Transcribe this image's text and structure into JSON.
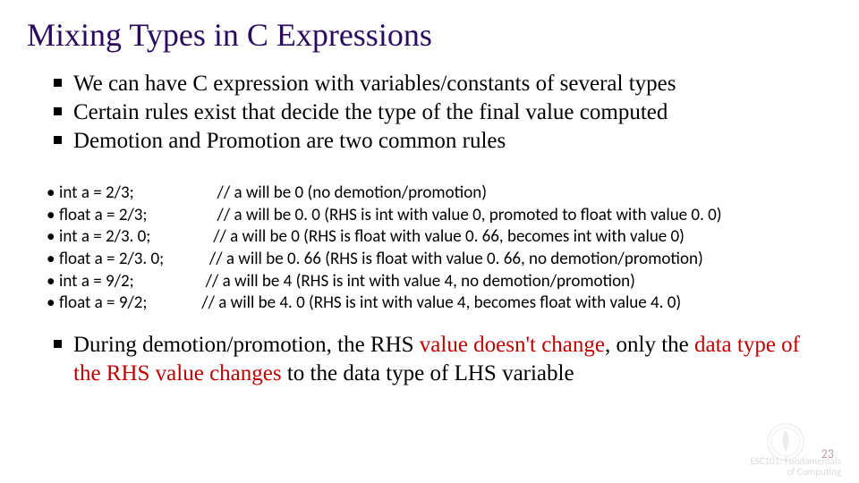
{
  "title": "Mixing Types in C Expressions",
  "intro": [
    "We can have C expression with variables/constants of several types",
    "Certain rules exist that decide the type of the final value computed",
    "Demotion and Promotion are two common rules"
  ],
  "examples": [
    {
      "decl": "int a = 2/3;",
      "comment": "// a will be 0 (no demotion/promotion)"
    },
    {
      "decl": "float a = 2/3;",
      "comment": "// a will be 0. 0 (RHS is int with value 0, promoted to float with value 0. 0)"
    },
    {
      "decl": "int a = 2/3. 0;",
      "comment": "// a will be 0 (RHS is float with value 0. 66, becomes int with value 0)"
    },
    {
      "decl": "float a = 2/3. 0;",
      "comment": "// a will be 0. 66 (RHS is float with value 0. 66, no demotion/promotion)"
    },
    {
      "decl": "int a = 9/2;",
      "comment": "// a will be 4 (RHS is int with value 4, no demotion/promotion)"
    },
    {
      "decl": "float a = 9/2;",
      "comment": "// a will be 4. 0 (RHS is int with value 4, becomes float with value 4. 0)"
    }
  ],
  "note_parts": {
    "p1": "During demotion/promotion, the RHS ",
    "p2": "value doesn't change",
    "p3": ", only the ",
    "p4": "data type of the RHS value changes ",
    "p5": "to the data type of LHS variable"
  },
  "page_number": "23",
  "footer_l1": "ESC101: Fundamentals",
  "footer_l2": "of Computing"
}
